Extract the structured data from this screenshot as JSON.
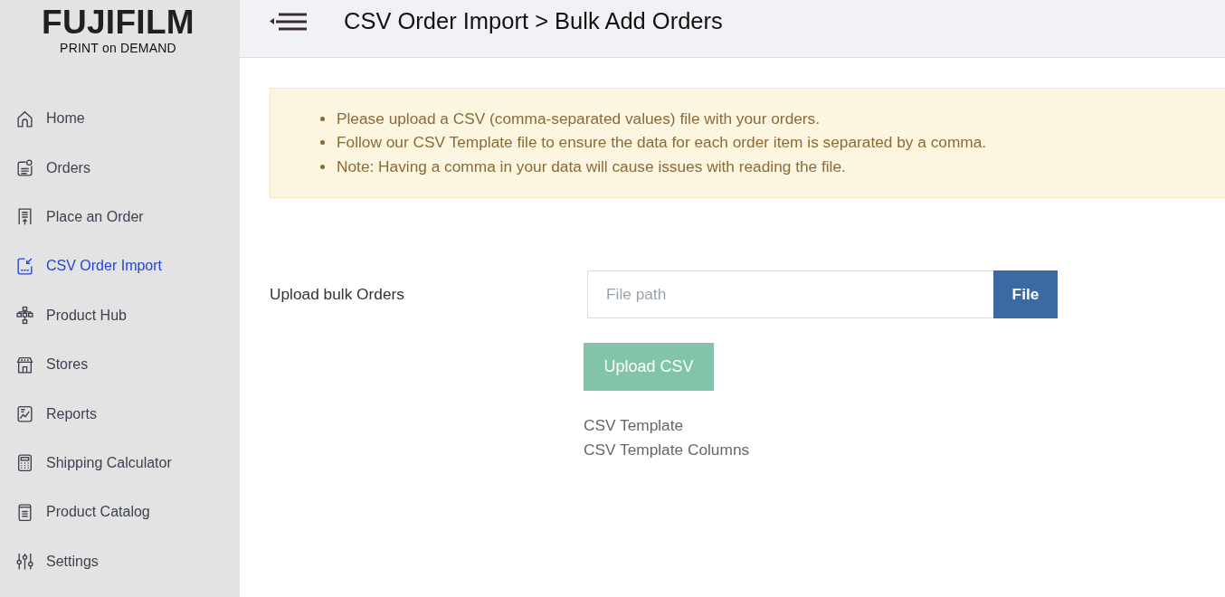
{
  "logo": {
    "brand": "FUJIFILM",
    "tagline": "PRINT on DEMAND"
  },
  "sidebar": {
    "items": [
      {
        "label": "Home",
        "selected": false
      },
      {
        "label": "Orders",
        "selected": false
      },
      {
        "label": "Place an Order",
        "selected": false
      },
      {
        "label": "CSV Order Import",
        "selected": true
      },
      {
        "label": "Product Hub",
        "selected": false
      },
      {
        "label": "Stores",
        "selected": false
      },
      {
        "label": "Reports",
        "selected": false
      },
      {
        "label": "Shipping Calculator",
        "selected": false
      },
      {
        "label": "Product Catalog",
        "selected": false
      },
      {
        "label": "Settings",
        "selected": false
      }
    ]
  },
  "header": {
    "title": "CSV Order Import > Bulk Add Orders"
  },
  "notice": {
    "items": [
      "Please upload a CSV (comma-separated values) file with your orders.",
      "Follow our CSV Template file to ensure the data for each order item is separated by a comma.",
      "Note: Having a comma in your data will cause issues with reading the file."
    ]
  },
  "upload_form": {
    "label": "Upload bulk Orders",
    "file_field": {
      "placeholder": "File path"
    },
    "file_button": "File",
    "upload_button": {
      "label": "Upload CSV",
      "disabled": true
    },
    "links": [
      "CSV Template",
      "CSV Template Columns"
    ]
  }
}
